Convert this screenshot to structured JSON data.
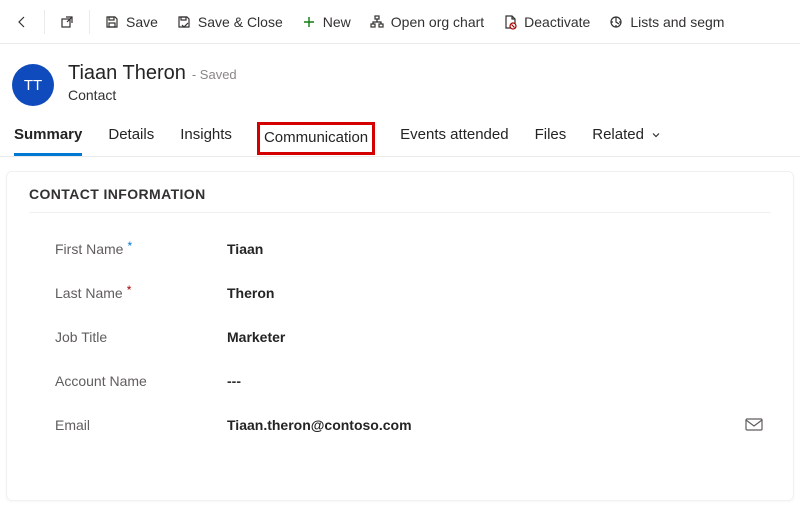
{
  "toolbar": {
    "save": "Save",
    "save_close": "Save & Close",
    "new": "New",
    "open_org": "Open org chart",
    "deactivate": "Deactivate",
    "lists_segm": "Lists and segm"
  },
  "header": {
    "initials": "TT",
    "title": "Tiaan Theron",
    "saved": "- Saved",
    "subtitle": "Contact"
  },
  "tabs": {
    "summary": "Summary",
    "details": "Details",
    "insights": "Insights",
    "communication": "Communication",
    "events": "Events attended",
    "files": "Files",
    "related": "Related"
  },
  "panel": {
    "title": "CONTACT INFORMATION",
    "fields": {
      "first_name": {
        "label": "First Name",
        "value": "Tiaan"
      },
      "last_name": {
        "label": "Last Name",
        "value": "Theron"
      },
      "job_title": {
        "label": "Job Title",
        "value": "Marketer"
      },
      "account_name": {
        "label": "Account Name",
        "value": "---"
      },
      "email": {
        "label": "Email",
        "value": "Tiaan.theron@contoso.com"
      }
    }
  }
}
